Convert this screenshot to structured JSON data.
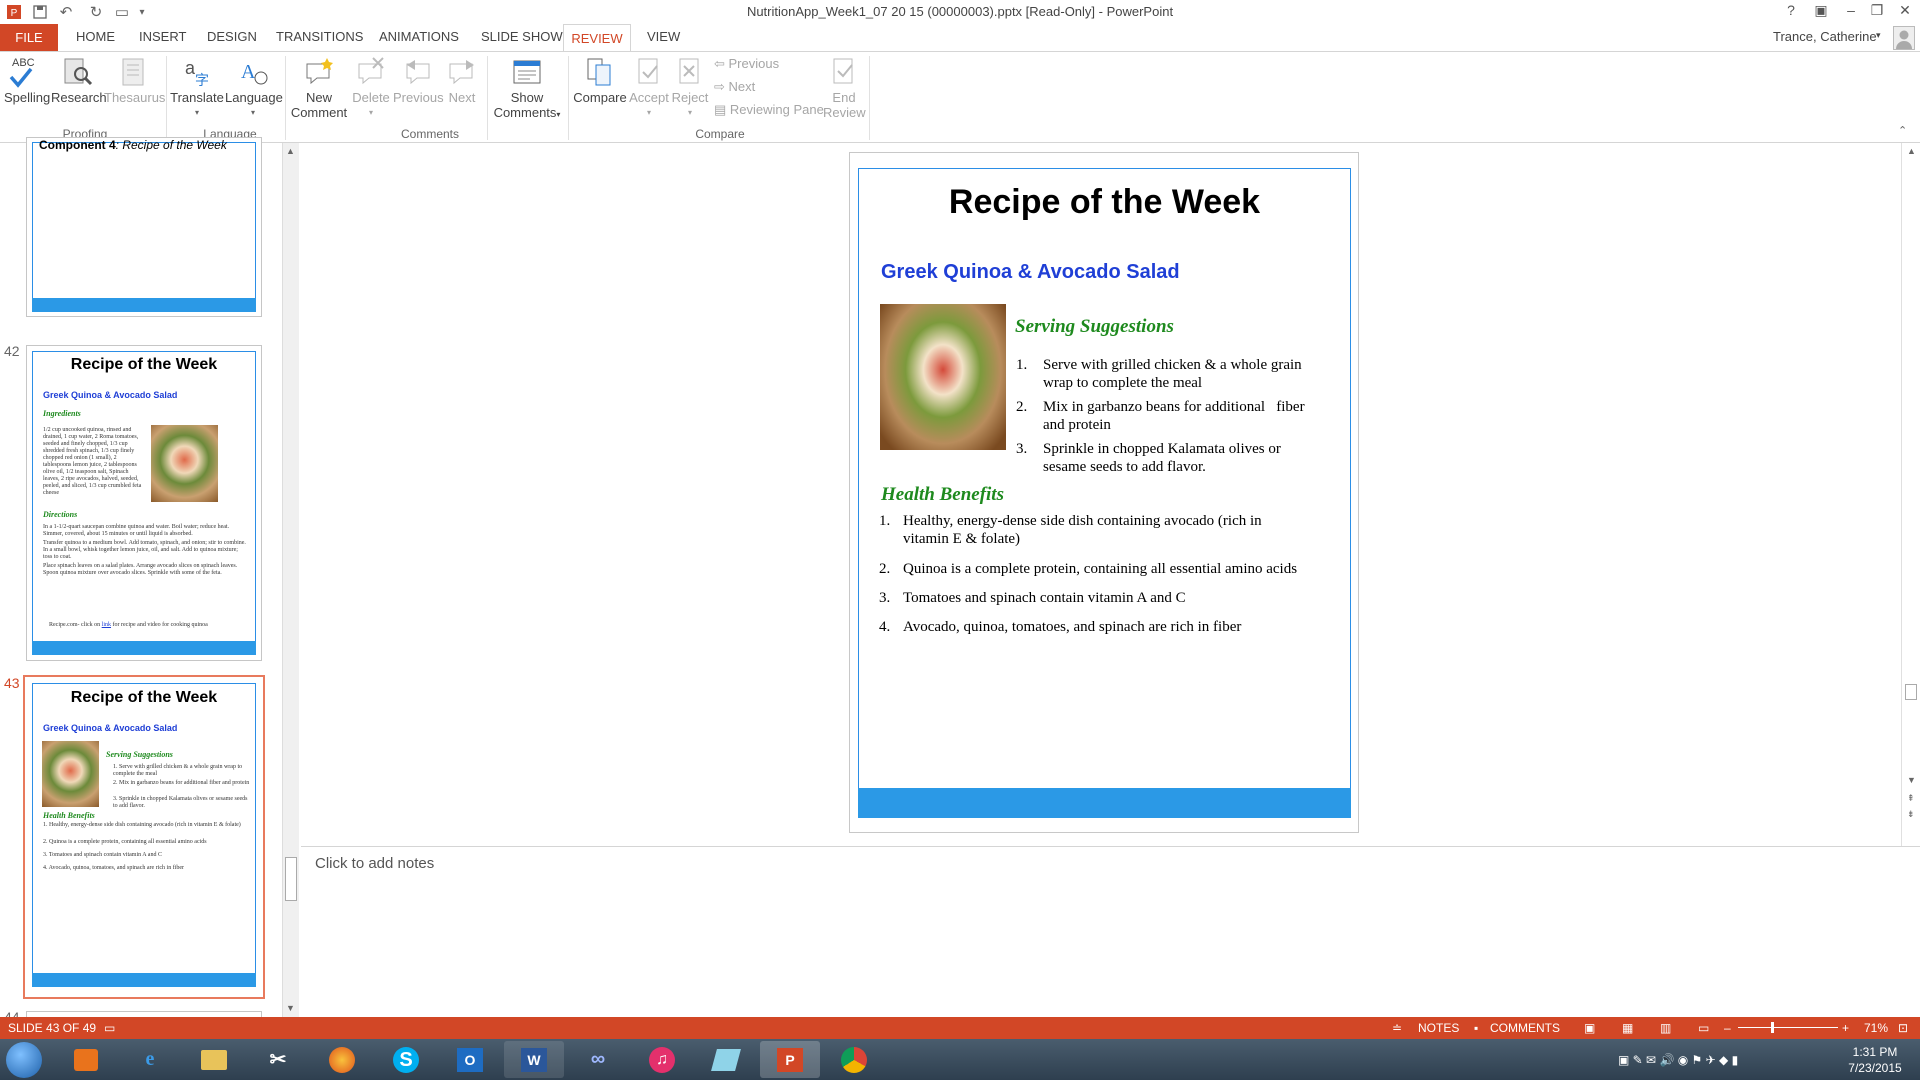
{
  "window": {
    "title": "NutritionApp_Week1_07 20 15 (00000003).pptx [Read-Only] - PowerPoint",
    "user": "Trance, Catherine",
    "help": "?"
  },
  "tabs": [
    "FILE",
    "HOME",
    "INSERT",
    "DESIGN",
    "TRANSITIONS",
    "ANIMATIONS",
    "SLIDE SHOW",
    "REVIEW",
    "VIEW"
  ],
  "ribbon": {
    "spelling": "Spelling",
    "spelling_abc": "ABC",
    "research": "Research",
    "thesaurus": "Thesaurus",
    "translate": "Translate",
    "language": "Language",
    "new_comment_1": "New",
    "new_comment_2": "Comment",
    "delete": "Delete",
    "previous": "Previous",
    "next": "Next",
    "show_comments_1": "Show",
    "show_comments_2": "Comments",
    "compare": "Compare",
    "accept": "Accept",
    "reject": "Reject",
    "cmp_previous": "Previous",
    "cmp_next": "Next",
    "reviewing_pane": "Reviewing Pane",
    "end_review_1": "End",
    "end_review_2": "Review",
    "groups": {
      "proofing": "Proofing",
      "language": "Language",
      "comments": "Comments",
      "compare": "Compare"
    }
  },
  "thumbnails": {
    "prev_slide_text_bold": "Component 4",
    "prev_slide_text_rest": ": Recipe of the Week",
    "slide42": {
      "num": "42",
      "title": "Recipe of the Week",
      "subtitle": "Greek Quinoa & Avocado Salad",
      "ingredients_head": "Ingredients",
      "ingredients_text": "1/2 cup uncooked quinoa, rinsed and drained, 1 cup water, 2 Roma tomatoes, seeded and finely chopped, 1/3 cup shredded fresh spinach, 1/3 cup finely chopped red onion (1 small), 2 tablespoons lemon juice, 2 tablespoons olive oil, 1/2 teaspoon salt, Spinach leaves, 2 ripe avocados, halved, seeded, peeled, and sliced, 1/3 cup crumbled feta cheese",
      "directions_head": "Directions",
      "directions": [
        "In a 1-1/2-quart saucepan combine quinoa and water. Boil water; reduce heat. Simmer, covered, about 15 minutes or until liquid is absorbed.",
        "Transfer quinoa to a medium bowl. Add tomato, spinach, and onion; stir to combine. In a small bowl, whisk together lemon juice, oil, and salt. Add to quinoa mixture; toss to coat.",
        "Place spinach leaves on a salad plates. Arrange avocado slices on spinach leaves. Spoon quinoa mixture over avocado slices. Sprinkle with some of the feta."
      ],
      "footer_pre": "Recipe.com- click on",
      "footer_link": "link",
      "footer_post": "for recipe and video for cooking quinoa"
    },
    "slide43": {
      "num": "43"
    },
    "slide44": {
      "num": "44"
    }
  },
  "slide": {
    "title": "Recipe of the Week",
    "subtitle": "Greek Quinoa & Avocado Salad",
    "serving_head": "Serving Suggestions",
    "serving": [
      {
        "n": "1.",
        "line1": "Serve with grilled chicken & a whole grain",
        "line2": "wrap to complete the meal"
      },
      {
        "n": "2.",
        "line1": "Mix in garbanzo beans for additional   fiber",
        "line2": "and protein"
      },
      {
        "n": "3.",
        "line1": "Sprinkle in chopped Kalamata olives or",
        "line2": "sesame seeds to add flavor."
      }
    ],
    "health_head": "Health Benefits",
    "health": [
      {
        "n": "1.",
        "line1": "Healthy, energy-dense side dish containing avocado (rich in",
        "line2": "vitamin E & folate)"
      },
      {
        "n": "2.",
        "line1": "Quinoa is a complete protein, containing all essential amino acids",
        "line2": ""
      },
      {
        "n": "3.",
        "line1": "Tomatoes and spinach contain vitamin A and C",
        "line2": ""
      },
      {
        "n": "4.",
        "line1": "Avocado, quinoa, tomatoes, and spinach are rich in fiber",
        "line2": ""
      }
    ]
  },
  "notes_placeholder": "Click to add notes",
  "status": {
    "slide": "SLIDE 43 OF 49",
    "notes": "NOTES",
    "comments": "COMMENTS",
    "zoom": "71%"
  },
  "taskbar": {
    "time": "1:31 PM",
    "date": "7/23/2015"
  },
  "colors": {
    "accent": "#d24726",
    "slide_blue": "#2b99e6",
    "title_blue": "#1f3fd6",
    "green": "#1e8a1e"
  }
}
